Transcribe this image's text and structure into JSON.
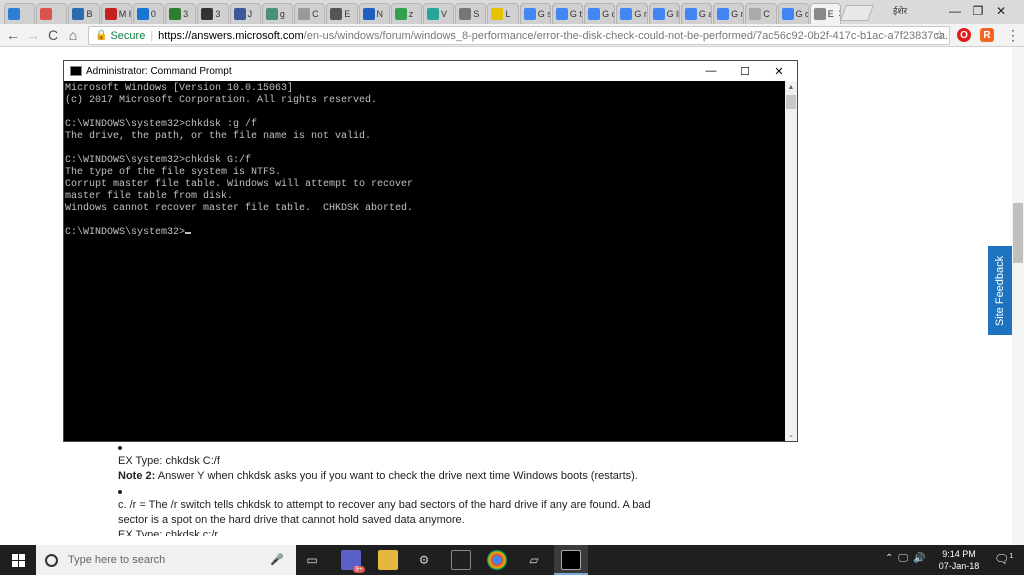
{
  "browser": {
    "tabs": [
      {
        "label": "",
        "color": "#2a7fd4"
      },
      {
        "label": "",
        "color": "#d9534f"
      },
      {
        "label": "B",
        "color": "#2b6cb0"
      },
      {
        "label": "M Ir",
        "color": "#c5221f"
      },
      {
        "label": "0",
        "color": "#1976d2"
      },
      {
        "label": "3",
        "color": "#2e7d32"
      },
      {
        "label": "3",
        "color": "#333333"
      },
      {
        "label": "J",
        "color": "#3b5998"
      },
      {
        "label": "g",
        "color": "#4a8f7a"
      },
      {
        "label": "C",
        "color": "#999999"
      },
      {
        "label": "E",
        "color": "#555555"
      },
      {
        "label": "N",
        "color": "#1e5fbf"
      },
      {
        "label": "z",
        "color": "#30a14e"
      },
      {
        "label": "V",
        "color": "#26a69a"
      },
      {
        "label": "S",
        "color": "#777777"
      },
      {
        "label": "L",
        "color": "#e6c200"
      },
      {
        "label": "G s",
        "color": "#4285f4"
      },
      {
        "label": "G t",
        "color": "#4285f4"
      },
      {
        "label": "G c",
        "color": "#4285f4"
      },
      {
        "label": "G n",
        "color": "#4285f4"
      },
      {
        "label": "G li",
        "color": "#4285f4"
      },
      {
        "label": "G a",
        "color": "#4285f4"
      },
      {
        "label": "G n",
        "color": "#4285f4"
      },
      {
        "label": "C",
        "color": "#aaaaaa"
      },
      {
        "label": "G c",
        "color": "#4285f4"
      },
      {
        "label": "E",
        "color": "#888888",
        "active": true
      }
    ],
    "user_label": "ईशेर",
    "window_controls": {
      "minimize": "—",
      "restore": "❐",
      "close": "✕"
    },
    "nav": {
      "back": "←",
      "forward": "→",
      "reload": "C",
      "home": "⌂"
    },
    "secure_label": "Secure",
    "url_host": "https://answers.microsoft.com",
    "url_path": "/en-us/windows/forum/windows_8-performance/error-the-disk-check-could-not-be-performed/7ac56c92-0b2f-417c-b1ac-a7f23837ca...",
    "bookmark_icon": "☆",
    "menu_icon": "⋮"
  },
  "cmd": {
    "title": "Administrator: Command Prompt",
    "minimize": "—",
    "maximize": "☐",
    "close": "✕",
    "lines": [
      "Microsoft Windows [Version 10.0.15063]",
      "(c) 2017 Microsoft Corporation. All rights reserved.",
      "",
      "C:\\WINDOWS\\system32>chkdsk :g /f",
      "The drive, the path, or the file name is not valid.",
      "",
      "C:\\WINDOWS\\system32>chkdsk G:/f",
      "The type of the file system is NTFS.",
      "Corrupt master file table. Windows will attempt to recover",
      "master file table from disk.",
      "Windows cannot recover master file table.  CHKDSK aborted.",
      ""
    ],
    "prompt": "C:\\WINDOWS\\system32>",
    "scroll_up": "▲",
    "scroll_down": "⌄"
  },
  "page": {
    "feedback_label": "Site Feedback",
    "line1": "EX Type: chkdsk C:/f",
    "note_label": "Note 2:",
    "note_text": " Answer Y when chkdsk asks you if you want to check the drive next time Windows boots (restarts).",
    "line3": "c.  /r = The /r switch tells chkdsk to attempt to recover any bad sectors of the hard drive if any are found. A bad sector is a spot on the hard drive that cannot hold saved data anymore.",
    "line4": "EX Type: chkdsk c:/r"
  },
  "taskbar": {
    "search_placeholder": "Type here to search",
    "mic_icon": "🎤",
    "tray": {
      "chevron": "⌃",
      "network": "🖵",
      "volume": "🔊"
    },
    "time": "9:14 PM",
    "date": "07-Jan-18",
    "notifications_icon": "🗨",
    "notifications_badge": "1",
    "badge_label": "9+"
  }
}
